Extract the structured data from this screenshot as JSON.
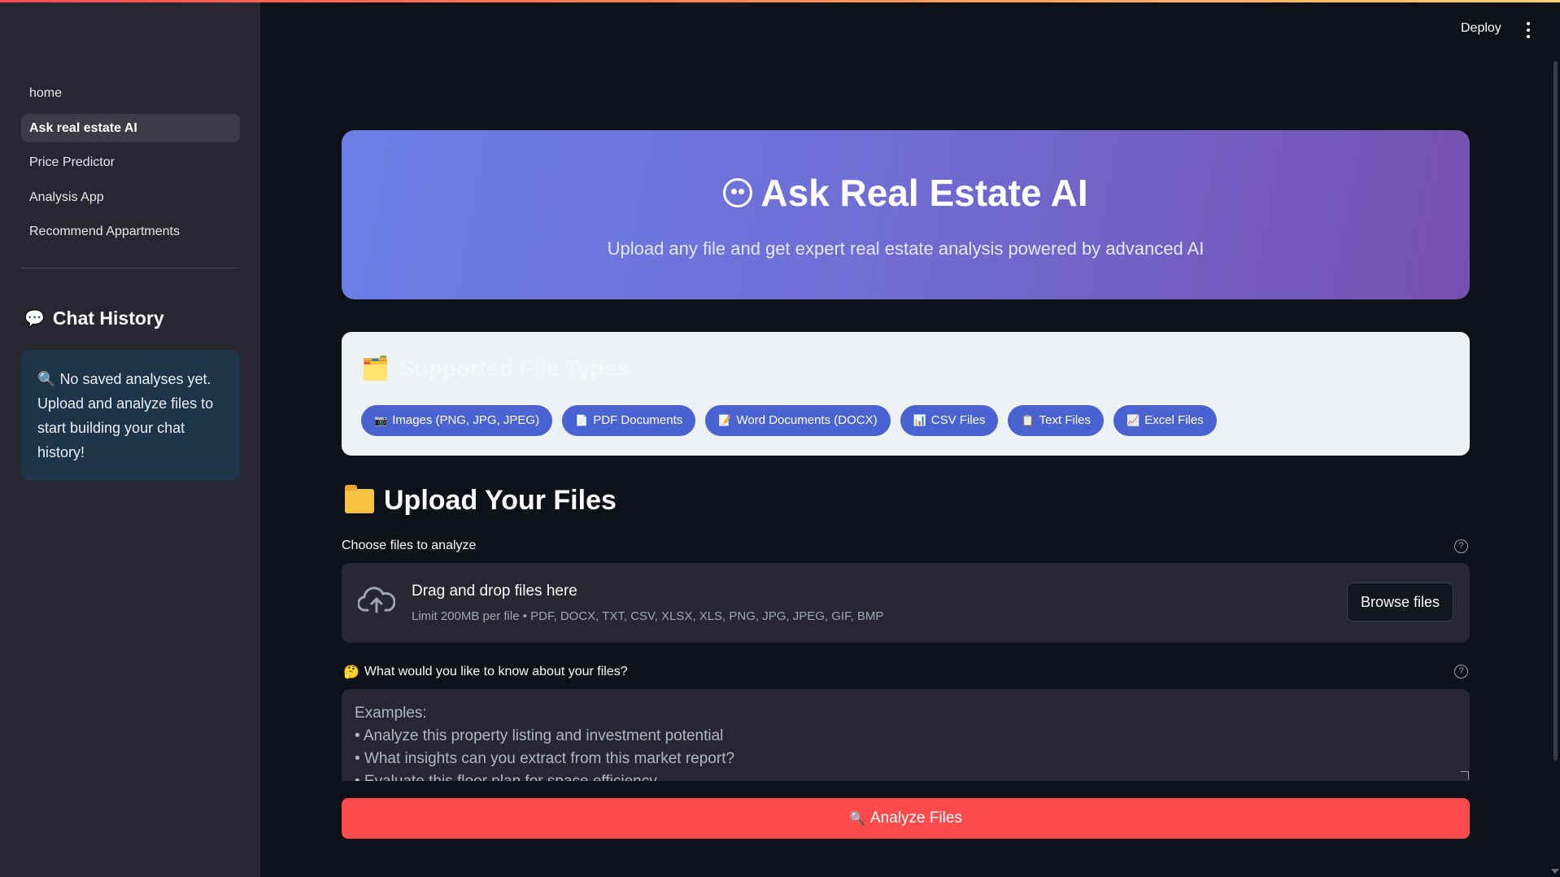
{
  "header": {
    "deploy_label": "Deploy"
  },
  "sidebar": {
    "nav": [
      {
        "label": "home",
        "active": false
      },
      {
        "label": "Ask real estate AI",
        "active": true
      },
      {
        "label": "Price Predictor",
        "active": false
      },
      {
        "label": "Analysis App",
        "active": false
      },
      {
        "label": "Recommend Appartments",
        "active": false
      }
    ],
    "chat_history": {
      "icon": "speech-bubble-icon",
      "title": "Chat History",
      "empty_icon": "magnifier-icon",
      "empty_text": "No saved analyses yet. Upload and analyze files to start building your chat history!"
    }
  },
  "hero": {
    "icon": "robot-face-icon",
    "title": "Ask Real Estate AI",
    "subtitle": "Upload any file and get expert real estate analysis powered by advanced AI"
  },
  "supported_types": {
    "icon": "card-index-dividers-icon",
    "title": "Supported File Types",
    "chips": [
      {
        "icon": "camera-icon",
        "label": "Images (PNG, JPG, JPEG)"
      },
      {
        "icon": "document-icon",
        "label": "PDF Documents"
      },
      {
        "icon": "memo-icon",
        "label": "Word Documents (DOCX)"
      },
      {
        "icon": "bar-chart-icon",
        "label": "CSV Files"
      },
      {
        "icon": "notepad-icon",
        "label": "Text Files"
      },
      {
        "icon": "trend-chart-icon",
        "label": "Excel Files"
      }
    ]
  },
  "upload": {
    "icon": "folder-icon",
    "title": "Upload Your Files",
    "field_label": "Choose files to analyze",
    "dropzone_title": "Drag and drop files here",
    "dropzone_limit": "Limit 200MB per file • PDF, DOCX, TXT, CSV, XLSX, XLS, PNG, JPG, JPEG, GIF, BMP",
    "browse_label": "Browse files"
  },
  "question": {
    "icon": "thinking-face-icon",
    "label": "What would you like to know about your files?",
    "placeholder": "Examples:\n• Analyze this property listing and investment potential\n• What insights can you extract from this market report?\n• Evaluate this floor plan for space efficiency"
  },
  "analyze": {
    "icon": "magnifier-icon",
    "label": "Analyze Files"
  },
  "colors": {
    "background": "#0e1117",
    "sidebar": "#262730",
    "primary_button": "#ff4b4b",
    "chip": "#4a63d2",
    "hero_gradient_start": "#6a7fe4",
    "hero_gradient_end": "#7650b0"
  }
}
